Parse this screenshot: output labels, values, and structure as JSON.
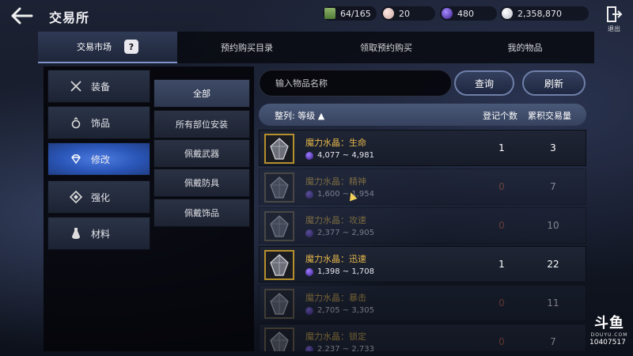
{
  "header": {
    "title": "交易所",
    "bag": "64/165",
    "pearl": "20",
    "crystal": "480",
    "silver": "2,358,870",
    "exit_label": "退出"
  },
  "tabs": [
    {
      "label": "交易市场"
    },
    {
      "label": "预约购买目录"
    },
    {
      "label": "领取预约购买"
    },
    {
      "label": "我的物品"
    }
  ],
  "help_label": "?",
  "categories": [
    {
      "label": "装备",
      "icon": "crossed-swords-icon"
    },
    {
      "label": "饰品",
      "icon": "ring-icon"
    },
    {
      "label": "修改",
      "icon": "gem-icon",
      "active": true
    },
    {
      "label": "强化",
      "icon": "diamond-icon"
    },
    {
      "label": "材料",
      "icon": "potion-icon"
    }
  ],
  "subcategories": [
    {
      "label": "全部",
      "active": true
    },
    {
      "label": "所有部位安装"
    },
    {
      "label": "佩戴武器"
    },
    {
      "label": "佩戴防具"
    },
    {
      "label": "佩戴饰品"
    }
  ],
  "search": {
    "placeholder": "输入物品名称",
    "query_label": "查询",
    "refresh_label": "刷新"
  },
  "table": {
    "sort_label": "整列: 等级",
    "sort_arrow": "▲",
    "col_count": "登记个数",
    "col_total": "累积交易量",
    "rows": [
      {
        "name": "魔力水晶：生命",
        "price": "4,077 ~ 4,981",
        "count": "1",
        "total": "3",
        "dim": false
      },
      {
        "name": "魔力水晶：精神",
        "price": "1,600 ~ 1,954",
        "count": "0",
        "total": "7",
        "dim": true
      },
      {
        "name": "魔力水晶：攻速",
        "price": "2,377 ~ 2,905",
        "count": "0",
        "total": "10",
        "dim": true
      },
      {
        "name": "魔力水晶：迅速",
        "price": "1,398 ~ 1,708",
        "count": "1",
        "total": "22",
        "dim": false
      },
      {
        "name": "魔力水晶：暴击",
        "price": "2,705 ~ 3,305",
        "count": "0",
        "total": "11",
        "dim": true
      },
      {
        "name": "魔力水晶：锁定",
        "price": "2,237 ~ 2,733",
        "count": "0",
        "total": "7",
        "dim": true
      }
    ]
  },
  "watermark": {
    "logo": "斗鱼",
    "sub": "DOUYU.COM",
    "room_id": "10407517"
  },
  "colors": {
    "accent_gold": "#e6b84a",
    "active_blue": "#2a56b8",
    "zero_count": "#c1603f"
  }
}
